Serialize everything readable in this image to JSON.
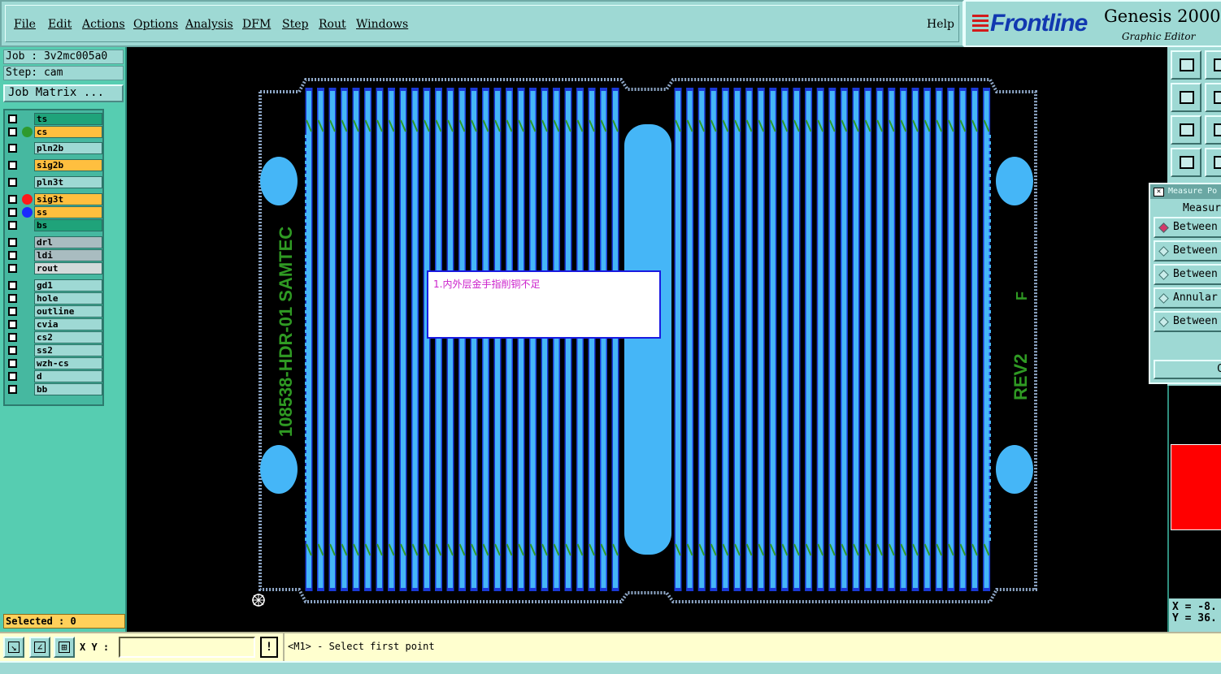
{
  "menu": {
    "items": [
      "File",
      "Edit",
      "Actions",
      "Options",
      "Analysis",
      "DFM",
      "Step",
      "Rout",
      "Windows"
    ],
    "help": "Help"
  },
  "brand": {
    "logo": "Frontline",
    "product": "Genesis 2000",
    "subtitle": "Graphic Editor"
  },
  "job": {
    "job_line": "Job : 3v2mc005a0",
    "step_line": "Step: cam",
    "matrix_button": "Job Matrix ..."
  },
  "layers": [
    {
      "name": "ts",
      "color": "#1fa37a",
      "dot": ""
    },
    {
      "name": "cs",
      "color": "#ffbf3f",
      "dot": "#2e9a2e",
      "active": true
    },
    {
      "name": "pln2b",
      "color": "#9ed9d4",
      "dot": ""
    },
    {
      "name": "sig2b",
      "color": "#ffbf3f",
      "dot": ""
    },
    {
      "name": "pln3t",
      "color": "#9ed9d4",
      "dot": ""
    },
    {
      "name": "sig3t",
      "color": "#ffbf3f",
      "dot": "#ff1a1a"
    },
    {
      "name": "ss",
      "color": "#ffbf3f",
      "dot": "#1a2aff"
    },
    {
      "name": "bs",
      "color": "#1fa37a",
      "dot": ""
    },
    {
      "name": "drl",
      "color": "#a9bcc0",
      "dot": ""
    },
    {
      "name": "ldi",
      "color": "#a9bcc0",
      "dot": ""
    },
    {
      "name": "rout",
      "color": "#d3dada",
      "dot": ""
    },
    {
      "name": "gd1",
      "color": "#9ed9d4",
      "dot": ""
    },
    {
      "name": "hole",
      "color": "#9ed9d4",
      "dot": ""
    },
    {
      "name": "outline",
      "color": "#9ed9d4",
      "dot": ""
    },
    {
      "name": "cvia",
      "color": "#9ed9d4",
      "dot": ""
    },
    {
      "name": "cs2",
      "color": "#9ed9d4",
      "dot": ""
    },
    {
      "name": "ss2",
      "color": "#9ed9d4",
      "dot": ""
    },
    {
      "name": "wzh-cs",
      "color": "#9ed9d4",
      "dot": ""
    },
    {
      "name": "d",
      "color": "#9ed9d4",
      "dot": ""
    },
    {
      "name": "bb",
      "color": "#9ed9d4",
      "dot": ""
    }
  ],
  "selected_label": "Selected : 0",
  "board": {
    "left_text": "108538-HDR-01  SAMTEC",
    "right_text": "REV2",
    "right_mark": "F",
    "annotation": "1.内外层金手指削铜不足"
  },
  "measure": {
    "title": "Measure Po",
    "heading": "Measur",
    "options": [
      {
        "label": "Between",
        "selected": true
      },
      {
        "label": "Between",
        "selected": false
      },
      {
        "label": "Between",
        "selected": false
      },
      {
        "label": "Annular",
        "selected": false
      },
      {
        "label": "Between",
        "selected": false
      }
    ],
    "close_label": "Cl"
  },
  "coords": {
    "x_line": "X = -8.",
    "y_line": "Y = 36."
  },
  "bottom": {
    "xy_label": "X Y :",
    "xy_value": "",
    "bang": "!",
    "status": "<M1> - Select first point"
  },
  "colors": {
    "panel": "#9ed9d4",
    "layer_bg": "#56cdb1",
    "pad": "#45b6f7",
    "trace": "#1a3ad8",
    "silk": "#2f9a23"
  }
}
